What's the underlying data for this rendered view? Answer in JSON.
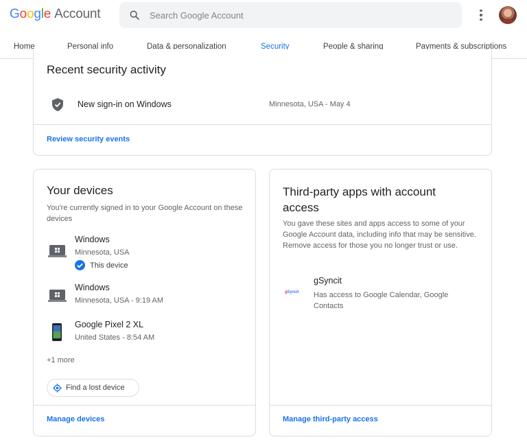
{
  "header": {
    "logo_google": [
      "G",
      "o",
      "o",
      "g",
      "l",
      "e"
    ],
    "logo_account": "Account",
    "search_placeholder": "Search Google Account"
  },
  "tabs": [
    {
      "label": "Home"
    },
    {
      "label": "Personal info"
    },
    {
      "label": "Data & personalization"
    },
    {
      "label": "Security",
      "active": true
    },
    {
      "label": "People & sharing"
    },
    {
      "label": "Payments & subscriptions"
    }
  ],
  "activity": {
    "title": "Recent security activity",
    "event": {
      "label": "New sign-in on Windows",
      "meta": "Minnesota, USA - May 4",
      "icon": "shield-icon"
    },
    "link": "Review security events"
  },
  "devices": {
    "title": "Your devices",
    "subtitle": "You're currently signed in to your Google Account on these devices",
    "items": [
      {
        "name": "Windows",
        "location": "Minnesota, USA",
        "this_device": "This device",
        "icon": "laptop-icon"
      },
      {
        "name": "Windows",
        "location": "Minnesota, USA - 9:19 AM",
        "icon": "laptop-icon"
      },
      {
        "name": "Google Pixel 2 XL",
        "location": "United States - 8:54 AM",
        "icon": "phone-icon"
      }
    ],
    "more": "+1 more",
    "find_button": "Find a lost device",
    "link": "Manage devices"
  },
  "apps": {
    "title": "Third-party apps with account access",
    "subtitle": "You gave these sites and apps access to some of your Google Account data, including info that may be sensitive. Remove access for those you no longer trust or use.",
    "app": {
      "name": "gSyncit",
      "access": "Has access to Google Calendar, Google Contacts",
      "logo_text": "gSyncit"
    },
    "link": "Manage third-party access"
  },
  "colors": {
    "accent": "#1a73e8",
    "border": "#dadce0",
    "muted": "#5f6368"
  }
}
